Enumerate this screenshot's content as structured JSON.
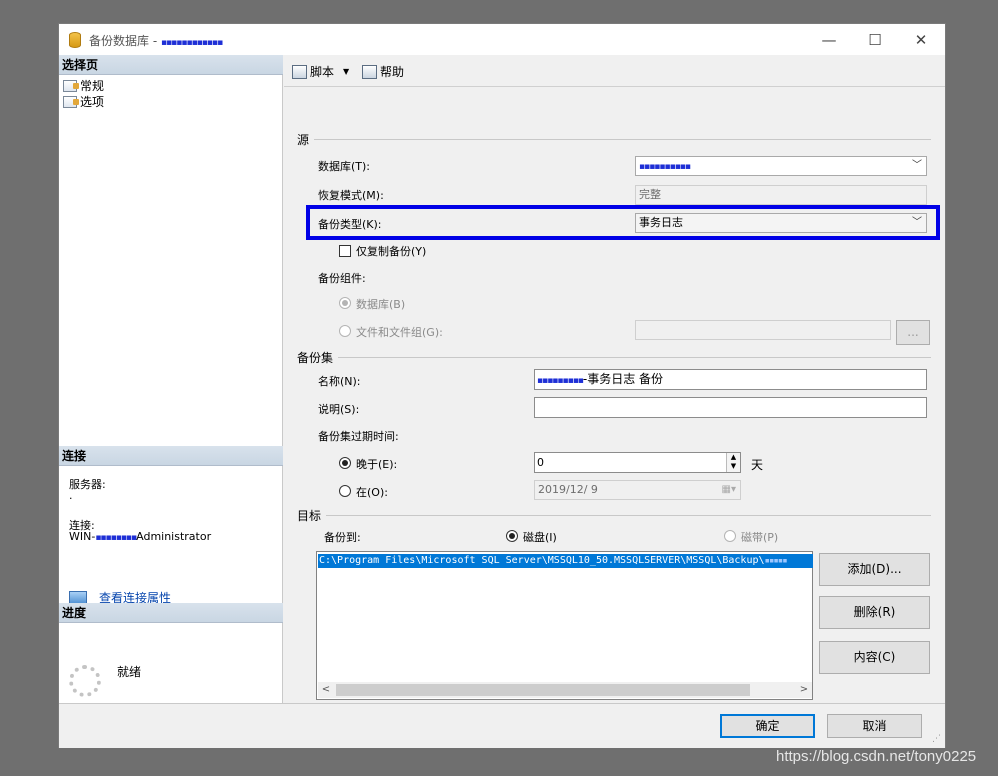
{
  "window": {
    "title": "备份数据库 - ",
    "title_redacted": "▪▪▪▪▪▪▪▪▪▪▪▪",
    "min": "—",
    "max": "☐",
    "close": "✕"
  },
  "left": {
    "select_page_header": "选择页",
    "pages": [
      {
        "label": "常规",
        "icon": "page-settings-icon"
      },
      {
        "label": "选项",
        "icon": "page-settings-icon"
      }
    ],
    "connection_header": "连接",
    "server_label": "服务器:",
    "server_value": ".",
    "conn_label": "连接:",
    "conn_value_prefix": "WIN-",
    "conn_value_redacted": "▪▪▪▪▪▪▪▪",
    "conn_value_suffix": "Administrator",
    "view_link": "查看连接属性",
    "progress_header": "进度",
    "progress_status": "就绪"
  },
  "toolbar": {
    "script_label": "脚本",
    "dropdown_arrow": "▼",
    "help_label": "帮助"
  },
  "source": {
    "group": "源",
    "database_label": "数据库(T):",
    "database_value_redacted": "▪▪▪▪▪▪▪▪▪▪",
    "recovery_label": "恢复模式(M):",
    "recovery_value": "完整",
    "backup_type_label": "备份类型(K):",
    "backup_type_value": "事务日志",
    "copy_only_label": "仅复制备份(Y)",
    "component_label": "备份组件:",
    "component_database": "数据库(B)",
    "component_files": "文件和文件组(G):",
    "browse_button": "..."
  },
  "backup_set": {
    "group": "备份集",
    "name_label": "名称(N):",
    "name_redacted": "▪▪▪▪▪▪▪▪▪",
    "name_value": "-事务日志  备份",
    "desc_label": "说明(S):",
    "desc_value": "",
    "expire_label": "备份集过期时间:",
    "after_label": "晚于(E):",
    "after_value": "0",
    "after_unit": "天",
    "on_label": "在(O):",
    "on_value": "2019/12/ 9"
  },
  "destination": {
    "group": "目标",
    "backup_to_label": "备份到:",
    "disk_label": "磁盘(I)",
    "tape_label": "磁带(P)",
    "path": "C:\\Program Files\\Microsoft SQL Server\\MSSQL10_50.MSSQLSERVER\\MSSQL\\Backup\\",
    "path_redacted": "▪▪▪▪▪",
    "add_button": "添加(D)...",
    "remove_button": "删除(R)",
    "contents_button": "内容(C)"
  },
  "footer": {
    "ok": "确定",
    "cancel": "取消",
    "watermark": "https://blog.csdn.net/tony0225"
  },
  "colors": {
    "highlight_border": "#0000e6",
    "selection": "#0078d7"
  }
}
